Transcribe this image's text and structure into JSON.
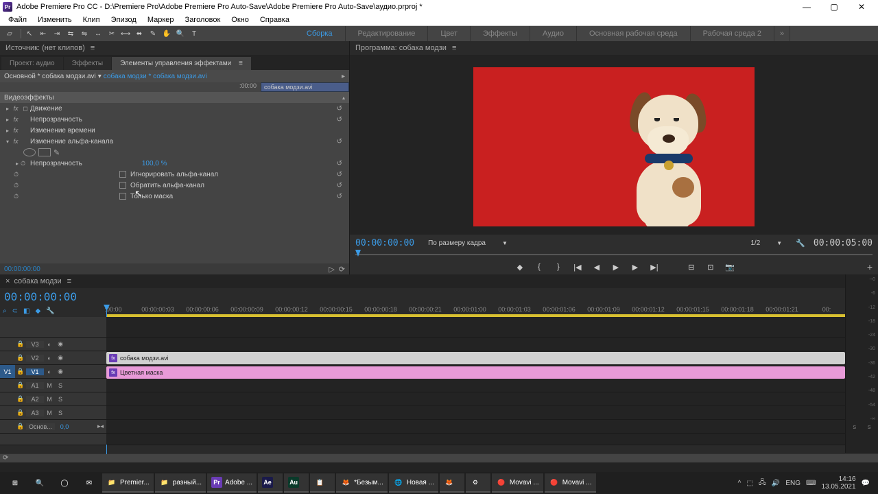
{
  "title_bar": {
    "app_icon_text": "Pr",
    "title": "Adobe Premiere Pro CC - D:\\Premiere Pro\\Adobe Premiere Pro Auto-Save\\Adobe Premiere Pro Auto-Save\\аудио.prproj *"
  },
  "menu": [
    "Файл",
    "Изменить",
    "Клип",
    "Эпизод",
    "Маркер",
    "Заголовок",
    "Окно",
    "Справка"
  ],
  "workspaces": {
    "items": [
      "Сборка",
      "Редактирование",
      "Цвет",
      "Эффекты",
      "Аудио",
      "Основная рабочая среда",
      "Рабочая среда 2"
    ],
    "active_index": 0
  },
  "source_panel": {
    "header": "Источник: (нет клипов)"
  },
  "ec_tabs": {
    "items": [
      "Проект: аудио",
      "Эффекты",
      "Элементы управления эффектами"
    ],
    "active_index": 2
  },
  "ec": {
    "master": "Основной * собака модзи.avi",
    "instance": "собака модзи * собака модзи.avi",
    "mini_tc": ":00:00",
    "clip_label": "собака модзи.avi",
    "section": "Видеоэффекты",
    "rows": {
      "motion": "Движение",
      "opacity": "Непрозрачность",
      "time_remap": "Изменение времени",
      "alpha_adjust": "Изменение альфа-канала",
      "alpha_opacity": "Непрозрачность",
      "alpha_opacity_val": "100,0 %",
      "ignore": "Игнорировать альфа-канал",
      "invert": "Обратить альфа-канал",
      "mask_only": "Только маска"
    },
    "footer_tc": "00:00:00:00"
  },
  "program": {
    "header_prefix": "Программа:",
    "header_name": "собака модзи",
    "tc_in": "00:00:00:00",
    "fit": "По размеру кадра",
    "res": "1/2",
    "tc_out": "00:00:05:00"
  },
  "timeline": {
    "seq_name": "собака модзи",
    "big_tc": "00:00:00:00",
    "ruler": [
      ":00:00",
      "00:00:00:03",
      "00:00:00:06",
      "00:00:00:09",
      "00:00:00:12",
      "00:00:00:15",
      "00:00:00:18",
      "00:00:00:21",
      "00:00:01:00",
      "00:00:01:03",
      "00:00:01:06",
      "00:00:01:09",
      "00:00:01:12",
      "00:00:01:15",
      "00:00:01:18",
      "00:00:01:21",
      "00:"
    ],
    "tracks": {
      "v3": "V3",
      "v2": "V2",
      "v1": "V1",
      "v1_src": "V1",
      "a1": "A1",
      "a2": "A2",
      "a3": "A3",
      "master": "Основ...",
      "master_val": "0,0"
    },
    "clips": {
      "video": "собака модзи.avi",
      "matte": "Цветная маска"
    }
  },
  "meter": {
    "ticks": [
      "--0",
      "-6",
      "-12",
      "-18",
      "-24",
      "-30",
      "-36",
      "-42",
      "-48",
      "-54",
      "-∞"
    ],
    "s_left": "S",
    "s_right": "S"
  },
  "taskbar": {
    "apps": [
      {
        "icon": "📁",
        "label": "Premier..."
      },
      {
        "icon": "📁",
        "label": "разный..."
      },
      {
        "icon": "Pr",
        "label": "Adobe ...",
        "color": "#6a3cb5"
      },
      {
        "icon": "Ae",
        "label": "",
        "color": "#1a1a4a"
      },
      {
        "icon": "Au",
        "label": "",
        "color": "#0a3a2a"
      },
      {
        "icon": "📋",
        "label": ""
      },
      {
        "icon": "🦊",
        "label": "*Безым..."
      },
      {
        "icon": "🌐",
        "label": "Новая ..."
      },
      {
        "icon": "🦊",
        "label": ""
      },
      {
        "icon": "⚙",
        "label": ""
      },
      {
        "icon": "🔴",
        "label": "Movavi ..."
      },
      {
        "icon": "🔴",
        "label": "Movavi ..."
      }
    ],
    "lang": "ENG",
    "time": "14:16",
    "date": "13.05.2021"
  }
}
